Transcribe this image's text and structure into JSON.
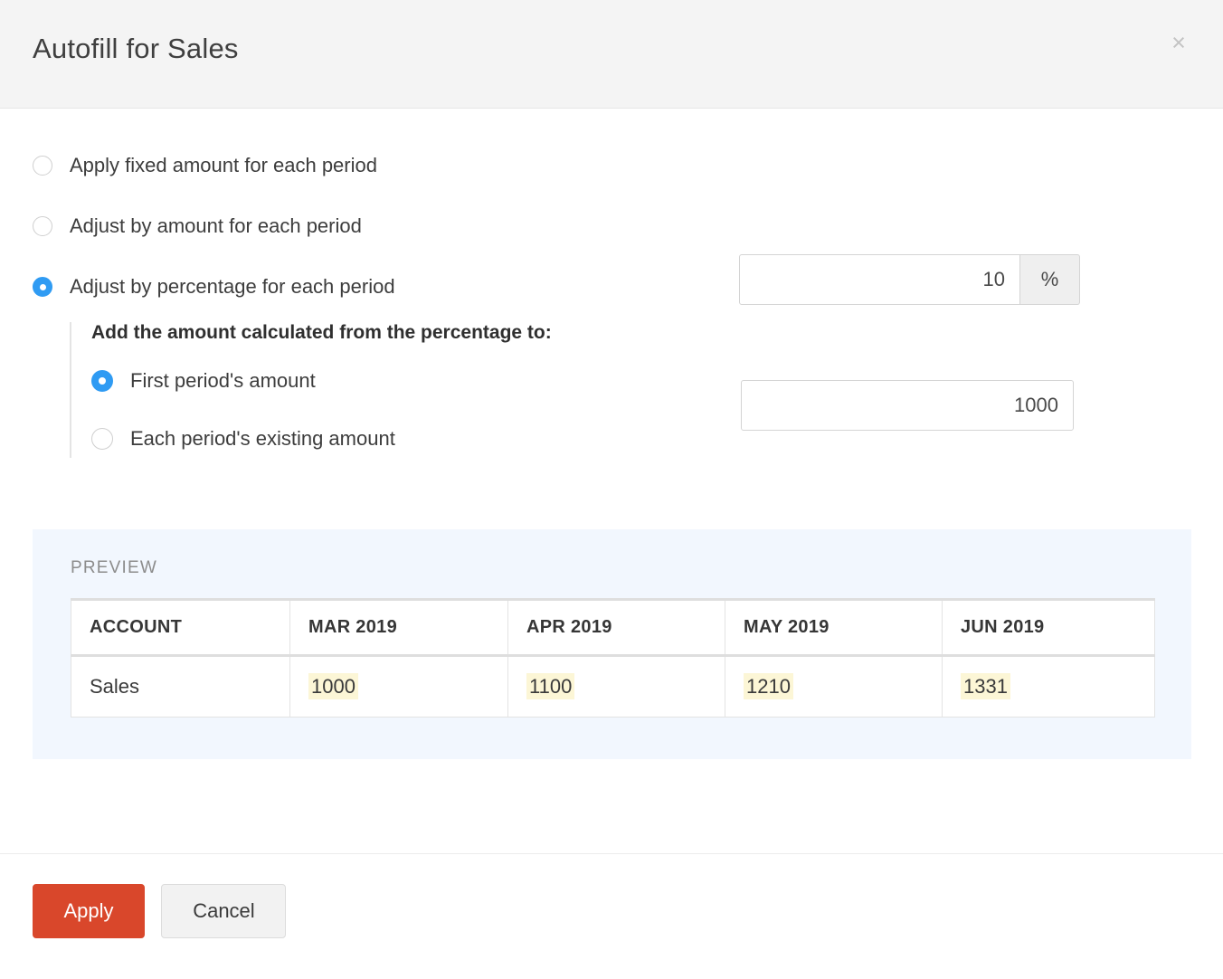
{
  "dialog": {
    "title": "Autofill for Sales",
    "close_label": "×"
  },
  "options": [
    {
      "label": "Apply fixed amount for each period",
      "selected": false
    },
    {
      "label": "Adjust by amount for each period",
      "selected": false
    },
    {
      "label": "Adjust by percentage for each period",
      "selected": true
    }
  ],
  "percentage_input": {
    "value": "10",
    "placeholder": "",
    "addon": "%"
  },
  "sub_section": {
    "title": "Add the amount calculated from the percentage to:",
    "options": [
      {
        "label": "First period's amount",
        "selected": true
      },
      {
        "label": "Each period's existing amount",
        "selected": false
      }
    ],
    "amount_input": {
      "value": "1000",
      "placeholder": ""
    }
  },
  "preview": {
    "label": "PREVIEW",
    "columns": [
      "ACCOUNT",
      "MAR 2019",
      "APR 2019",
      "MAY 2019",
      "JUN 2019"
    ],
    "rows": [
      {
        "account": "Sales",
        "values": [
          "1000",
          "1100",
          "1210",
          "1331"
        ]
      }
    ]
  },
  "footer": {
    "apply_label": "Apply",
    "cancel_label": "Cancel"
  },
  "colors": {
    "accent_blue": "#2f9bf3",
    "apply_red": "#d9472b",
    "preview_bg": "#f2f7fe",
    "highlight_yellow": "#fcf6d6",
    "header_bg": "#f4f4f4"
  }
}
